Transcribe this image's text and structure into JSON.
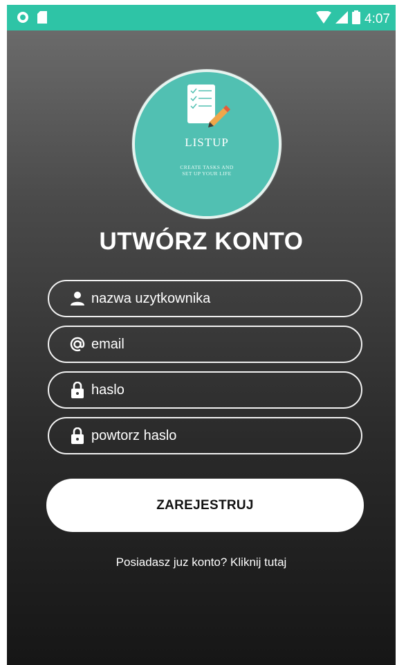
{
  "status_bar": {
    "time": "4:07",
    "icons": [
      "circle-notification-icon",
      "sd-card-icon",
      "wifi-icon",
      "signal-icon",
      "battery-icon"
    ]
  },
  "logo": {
    "title": "LISTUP",
    "tagline": "CREATE TASKS AND SET UP YOUR LIFE",
    "icon": "checklist-pencil-icon"
  },
  "heading": "UTWÓRZ KONTO",
  "form": {
    "username": {
      "placeholder": "nazwa uzytkownika",
      "icon": "person-icon"
    },
    "email": {
      "placeholder": "email",
      "icon": "at-sign-icon"
    },
    "password": {
      "placeholder": "haslo",
      "icon": "lock-icon"
    },
    "password_repeat": {
      "placeholder": "powtorz haslo",
      "icon": "lock-icon"
    }
  },
  "register_button": "ZAREJESTRUJ",
  "login_link": "Posiadasz juz konto? Kliknij tutaj",
  "colors": {
    "status_bar": "#2ec4a6",
    "logo_circle": "#51c0b2",
    "button_bg": "#ffffff",
    "text": "#ffffff"
  }
}
